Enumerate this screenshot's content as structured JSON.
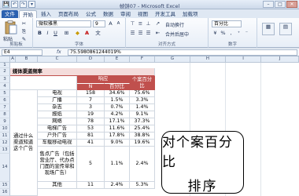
{
  "window": {
    "title": "帧饼07 - Microsoft Excel",
    "qat": [
      "💾",
      "↶",
      "↷",
      "▾"
    ],
    "buttons": {
      "minimize": "–",
      "restore": "□",
      "close": "✕"
    }
  },
  "tabs": [
    "文件",
    "开始",
    "插入",
    "页面布局",
    "公式",
    "数据",
    "审阅",
    "视图",
    "开发工具",
    "加载项"
  ],
  "ribbon": {
    "clipboard": {
      "paste": "粘贴",
      "label": "剪贴板"
    },
    "font": {
      "name": "微软雅黑",
      "size": "9",
      "label": "字体"
    },
    "alignment": {
      "label": "对齐方式",
      "wrap": "自动换行",
      "merge": "合并后居中"
    },
    "number": {
      "format": "百分比",
      "label": "数字"
    }
  },
  "formula_bar": {
    "cell_ref": "E4",
    "fx": "fx",
    "formula": "75.5980861244019%"
  },
  "columns": [
    "A",
    "B",
    "C",
    "D",
    "E",
    "F",
    "G",
    "H",
    "I",
    "J"
  ],
  "rows": [
    "1",
    "2",
    "3",
    "4",
    "5",
    "6",
    "7",
    "8",
    "9",
    "10",
    "11",
    "12",
    "13",
    "14",
    "15",
    "16",
    "17",
    "18",
    "19"
  ],
  "table": {
    "title": "媒体渠道频率",
    "header_group": "响应",
    "header_case_pct_line1": "个案百分",
    "header_case_pct_line2": "比",
    "sub_n": "N",
    "sub_pct": "百分比",
    "group_label": "通过什么渠道知道这个广告",
    "rows": [
      {
        "label": "电视",
        "n": "158",
        "pct": "34.6%",
        "case": "75.6%"
      },
      {
        "label": "广播",
        "n": "7",
        "pct": "1.5%",
        "case": "3.3%"
      },
      {
        "label": "杂志",
        "n": "3",
        "pct": "0.7%",
        "case": "1.4%"
      },
      {
        "label": "报纸",
        "n": "19",
        "pct": "4.2%",
        "case": "9.1%"
      },
      {
        "label": "网络",
        "n": "78",
        "pct": "17.1%",
        "case": "37.3%"
      },
      {
        "label": "电梯广告",
        "n": "53",
        "pct": "11.6%",
        "case": "25.4%"
      },
      {
        "label": "户外广告",
        "n": "81",
        "pct": "17.8%",
        "case": "38.8%"
      },
      {
        "label": "车载移动电视",
        "n": "41",
        "pct": "9.0%",
        "case": "19.6%"
      },
      {
        "label": "售点广告（包括营业厅、代办点门面的宣传单和现场广告）",
        "n": "5",
        "pct": "1.1%",
        "case": "2.4%"
      },
      {
        "label": "其他",
        "n": "11",
        "pct": "2.4%",
        "case": "5.3%"
      }
    ]
  },
  "callout": {
    "line1": "对个案百分比",
    "line2": "排序"
  },
  "colors": {
    "header_red": "#c0504d",
    "title_pink": "#f4dcdb",
    "file_tab": "#2b61b0"
  }
}
